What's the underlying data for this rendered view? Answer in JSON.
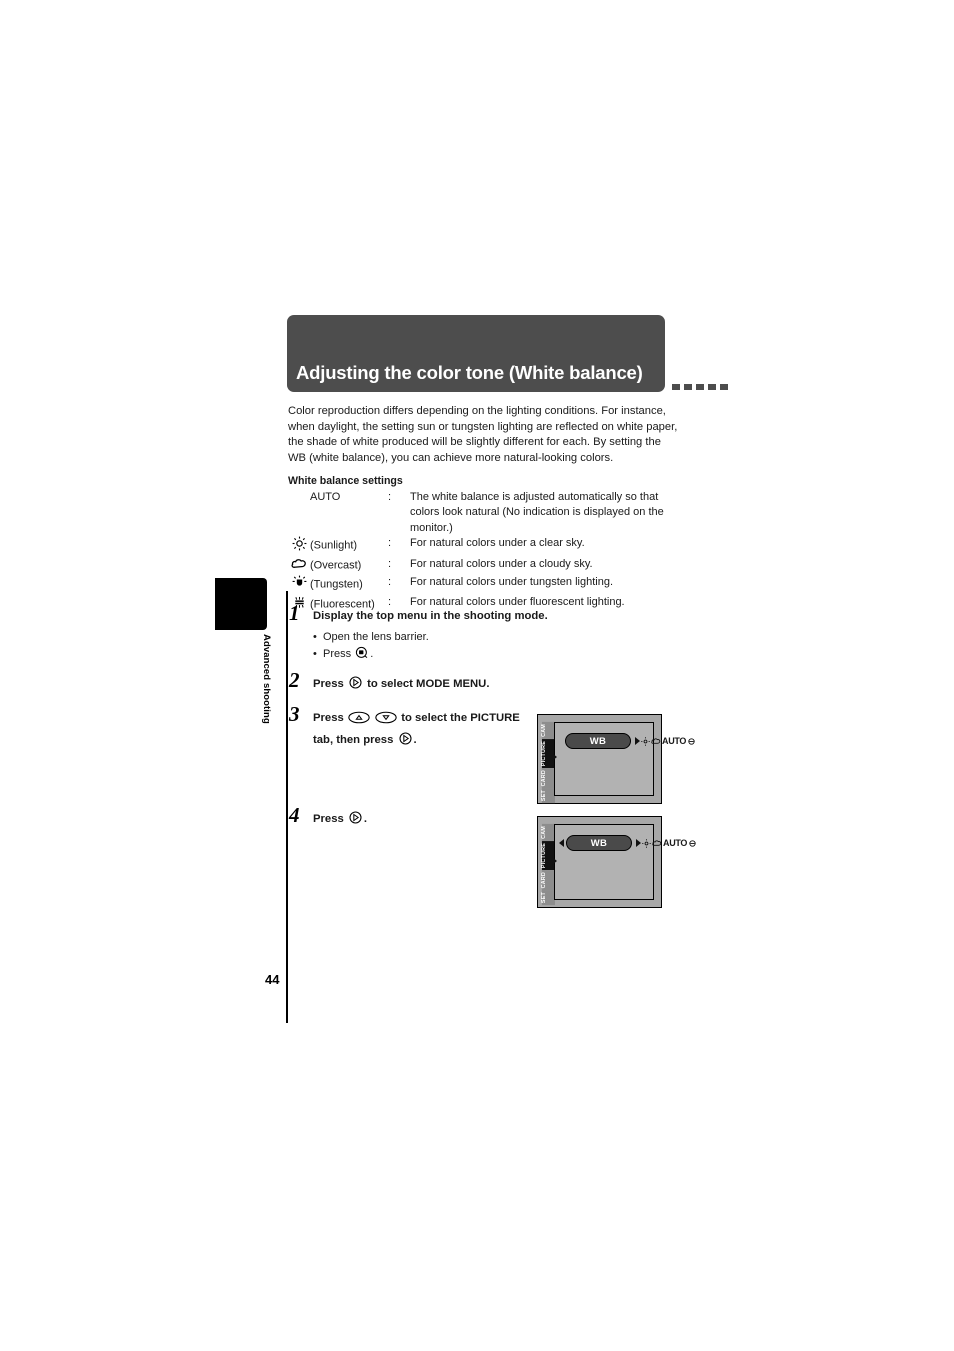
{
  "page": {
    "number": "44",
    "chapter_label": "Advanced shooting"
  },
  "header": {
    "title": "Adjusting the color tone (White balance)"
  },
  "intro": {
    "paragraph": "Color reproduction differs depending on the lighting conditions. For instance, when daylight, the setting sun or tungsten lighting are reflected on white paper, the shade of white produced will be slightly different for each. By setting the WB (white balance), you can achieve more natural-looking colors."
  },
  "settings": {
    "heading": "White balance settings",
    "colon": ":",
    "rows": [
      {
        "icon": "",
        "name": "AUTO",
        "desc": "The white balance is adjusted automatically so that colors look natural (No indication is displayed on the monitor.)"
      },
      {
        "icon": "sun-icon",
        "name": "(Sunlight)",
        "desc": "For natural colors under a clear sky."
      },
      {
        "icon": "cloud-icon",
        "name": "(Overcast)",
        "desc": "For natural colors under a cloudy sky."
      },
      {
        "icon": "tungsten-bulb-icon",
        "name": "(Tungsten)",
        "desc": "For natural colors under tungsten lighting."
      },
      {
        "icon": "fluorescent-tube-icon",
        "name": "(Fluorescent)",
        "desc": "For natural colors under fluorescent lighting."
      }
    ]
  },
  "steps": [
    {
      "number": "1",
      "title": "Display the top menu in the shooting mode.",
      "bullets": [
        {
          "text_before": "Open the lens barrier.",
          "glyph": "",
          "text_after": ""
        },
        {
          "text_before": "Press",
          "glyph": "menu-button-icon",
          "text_after": "."
        }
      ]
    },
    {
      "number": "2",
      "text_before": "Press",
      "glyph": "arrow-right-button-icon",
      "text_after": "to select MODE MENU."
    },
    {
      "number": "3",
      "text_before": "Press",
      "glyph_up": "arrow-up-button-icon",
      "glyph_down": "arrow-down-button-icon",
      "text_middle": "to select the PICTURE tab, then press",
      "glyph_right": "arrow-right-button-icon",
      "text_after": "."
    },
    {
      "number": "4",
      "text_before": "Press",
      "glyph": "arrow-right-button-icon",
      "text_after": "."
    }
  ],
  "lcd_screens": [
    {
      "id": "lcd-step3",
      "tabs": [
        "CAM",
        "PICTURE",
        "CARD",
        "SET"
      ],
      "active_tab": "PICTURE",
      "selected_item": "WB",
      "option_value": "AUTO",
      "has_left_arrow": false,
      "has_right_arrow": true
    },
    {
      "id": "lcd-step4",
      "tabs": [
        "CAM",
        "PICTURE",
        "CARD",
        "SET"
      ],
      "active_tab": "PICTURE",
      "selected_item": "WB",
      "option_value": "AUTO",
      "has_left_arrow": true,
      "has_right_arrow": true
    }
  ],
  "colors": {
    "header_band": "#4d4d4d",
    "chapter_tab": "#000000",
    "lcd_body": "#a8a8a8",
    "lcd_screen": "#b2b2b2",
    "pill": "#4a4a4a"
  }
}
